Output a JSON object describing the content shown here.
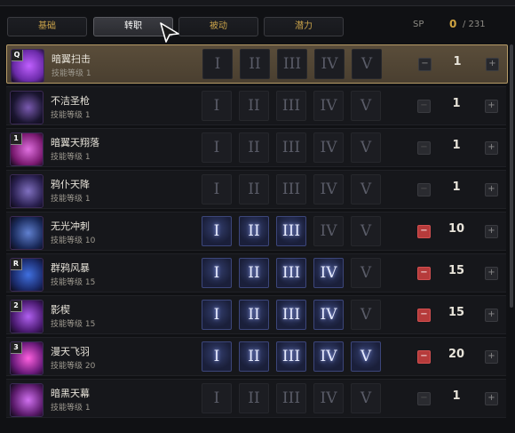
{
  "tabs": [
    {
      "label": "基础",
      "active": false
    },
    {
      "label": "转职",
      "active": true
    },
    {
      "label": "被动",
      "active": false
    },
    {
      "label": "潜力",
      "active": false
    }
  ],
  "sp": {
    "label": "SP",
    "current": "0",
    "max": "/ 231"
  },
  "level_prefix": "技能等级",
  "skills": [
    {
      "name": "暗翼扫击",
      "level": "1",
      "hotkey": "Q",
      "ranks_on": 0,
      "selected": true,
      "minus": "normal",
      "icon_colors": [
        "#6a2aa8",
        "#c060ff"
      ]
    },
    {
      "name": "不洁圣枪",
      "level": "1",
      "hotkey": "",
      "ranks_on": 0,
      "selected": false,
      "minus": "dim",
      "icon_colors": [
        "#1a1530",
        "#7a5ab0"
      ]
    },
    {
      "name": "暗翼天翔落",
      "level": "1",
      "hotkey": "1",
      "ranks_on": 0,
      "selected": false,
      "minus": "dim",
      "icon_colors": [
        "#7a1a70",
        "#e070e0"
      ]
    },
    {
      "name": "鸦仆天降",
      "level": "1",
      "hotkey": "",
      "ranks_on": 0,
      "selected": false,
      "minus": "dim",
      "icon_colors": [
        "#2a2050",
        "#8070c0"
      ]
    },
    {
      "name": "无光冲刺",
      "level": "10",
      "hotkey": "",
      "ranks_on": 3,
      "selected": false,
      "minus": "active",
      "icon_colors": [
        "#1a2a5a",
        "#6080d0"
      ]
    },
    {
      "name": "群鸦风暴",
      "level": "15",
      "hotkey": "R",
      "ranks_on": 4,
      "selected": false,
      "minus": "active",
      "icon_colors": [
        "#1a2a6a",
        "#4070e0"
      ]
    },
    {
      "name": "影楔",
      "level": "15",
      "hotkey": "2",
      "ranks_on": 4,
      "selected": false,
      "minus": "active",
      "icon_colors": [
        "#4a1a70",
        "#b060f0"
      ]
    },
    {
      "name": "漫天飞羽",
      "level": "20",
      "hotkey": "3",
      "ranks_on": 5,
      "selected": false,
      "minus": "active",
      "icon_colors": [
        "#6a1a7a",
        "#ff60e0"
      ]
    },
    {
      "name": "暗黑天幕",
      "level": "1",
      "hotkey": "",
      "ranks_on": 0,
      "selected": false,
      "minus": "dim",
      "icon_colors": [
        "#5a1a6a",
        "#d070f0"
      ]
    }
  ],
  "rank_numerals": [
    "I",
    "II",
    "III",
    "IV",
    "V"
  ],
  "plus_label": "+",
  "minus_label": "−"
}
